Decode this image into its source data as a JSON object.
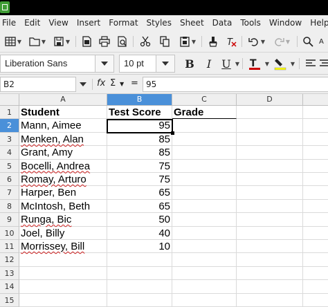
{
  "menu": [
    "File",
    "Edit",
    "View",
    "Insert",
    "Format",
    "Styles",
    "Sheet",
    "Data",
    "Tools",
    "Window",
    "Help"
  ],
  "format_bar": {
    "font_name": "Liberation Sans",
    "font_size": "10 pt",
    "bold": "B",
    "italic": "I",
    "underline": "U",
    "font_color": "#cc0000",
    "highlight_color": "#ffff00"
  },
  "formula_bar": {
    "cell_ref": "B2",
    "fx_label": "fx",
    "sum_label": "Σ",
    "equals_label": "=",
    "content": "95"
  },
  "columns": [
    "A",
    "B",
    "C",
    "D"
  ],
  "selected_column": "B",
  "selected_row": "2",
  "rows": [
    {
      "num": "1",
      "a": "Student",
      "b": "Test Score",
      "c": "Grade"
    },
    {
      "num": "2",
      "a": "Mann, Aimee",
      "b": "95",
      "c": ""
    },
    {
      "num": "3",
      "a": "Menken, Alan",
      "b": "85",
      "c": ""
    },
    {
      "num": "4",
      "a": "Grant, Amy",
      "b": "85",
      "c": ""
    },
    {
      "num": "5",
      "a": "Bocelli, Andrea",
      "b": "75",
      "c": ""
    },
    {
      "num": "6",
      "a": "Romay, Arturo",
      "b": "75",
      "c": ""
    },
    {
      "num": "7",
      "a": "Harper, Ben",
      "b": "65",
      "c": ""
    },
    {
      "num": "8",
      "a": "McIntosh, Beth",
      "b": "65",
      "c": ""
    },
    {
      "num": "9",
      "a": "Runga, Bic",
      "b": "50",
      "c": ""
    },
    {
      "num": "10",
      "a": "Joel, Billy",
      "b": "40",
      "c": ""
    },
    {
      "num": "11",
      "a": "Morrissey, Bill",
      "b": "10",
      "c": ""
    },
    {
      "num": "12",
      "a": "",
      "b": "",
      "c": ""
    },
    {
      "num": "13",
      "a": "",
      "b": "",
      "c": ""
    },
    {
      "num": "14",
      "a": "",
      "b": "",
      "c": ""
    },
    {
      "num": "15",
      "a": "",
      "b": "",
      "c": ""
    }
  ]
}
